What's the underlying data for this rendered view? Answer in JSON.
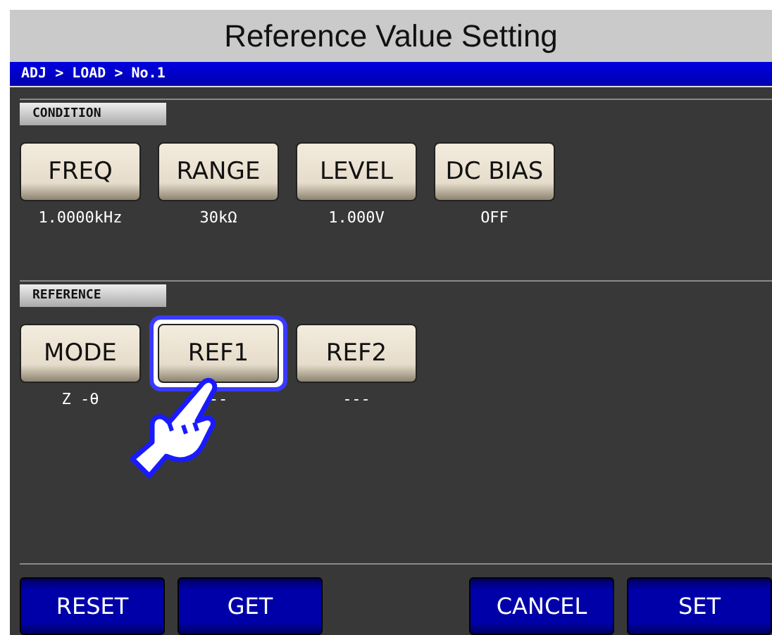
{
  "window": {
    "title": "Reference Value Setting"
  },
  "breadcrumb": "ADJ > LOAD > No.1",
  "sections": [
    {
      "label": "CONDITION",
      "items": [
        {
          "label": "FREQ",
          "value": "1.0000kHz",
          "selected": false
        },
        {
          "label": "RANGE",
          "value": "30kΩ",
          "selected": false
        },
        {
          "label": "LEVEL",
          "value": "1.000V",
          "selected": false
        },
        {
          "label": "DC BIAS",
          "value": "OFF",
          "selected": false
        }
      ]
    },
    {
      "label": "REFERENCE",
      "items": [
        {
          "label": "MODE",
          "value": "Z -θ",
          "selected": false
        },
        {
          "label": "REF1",
          "value": "--",
          "selected": true
        },
        {
          "label": "REF2",
          "value": "---",
          "selected": false
        }
      ]
    }
  ],
  "footer": {
    "left": [
      "RESET",
      "GET"
    ],
    "right": [
      "CANCEL",
      "SET"
    ]
  }
}
